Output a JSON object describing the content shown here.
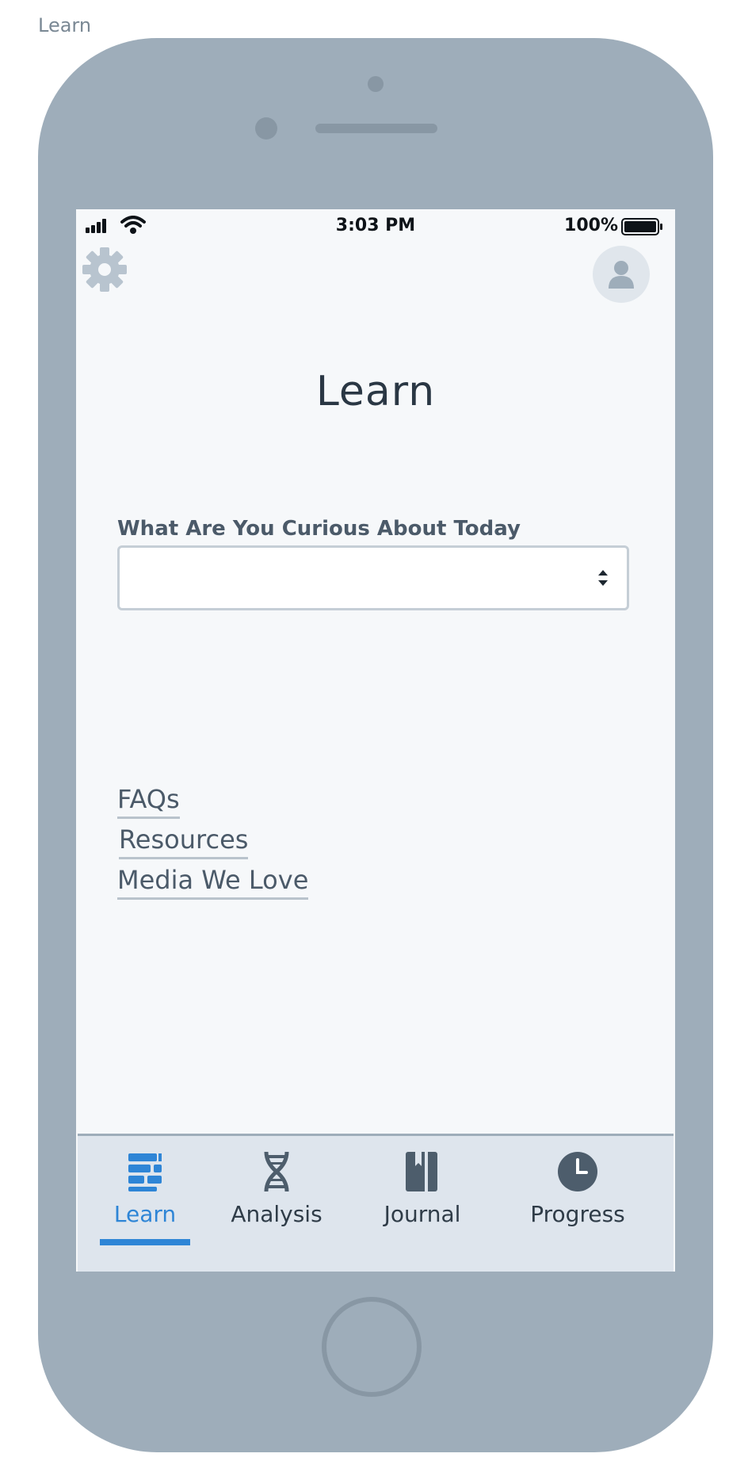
{
  "frame": {
    "label": "Learn"
  },
  "status_bar": {
    "time": "3:03 PM",
    "battery": "100%"
  },
  "header": {
    "title": "Learn"
  },
  "topic_select": {
    "label": "What Are You Curious About Today",
    "value": ""
  },
  "links": [
    "FAQs",
    "Resources",
    "Media We Love"
  ],
  "tab_bar": {
    "items": [
      {
        "label": "Learn",
        "icon": "learn-bars-icon",
        "active": true
      },
      {
        "label": "Analysis",
        "icon": "dna-icon",
        "active": false
      },
      {
        "label": "Journal",
        "icon": "journal-book-icon",
        "active": false
      },
      {
        "label": "Progress",
        "icon": "clock-icon",
        "active": false
      }
    ]
  },
  "colors": {
    "accent": "#2e85d6",
    "device": "#9eadba",
    "screen_bg": "#f6f8fa",
    "tab_bar_bg": "#dee5ed",
    "text_dark": "#2a3744",
    "text_muted": "#4b5a69"
  }
}
